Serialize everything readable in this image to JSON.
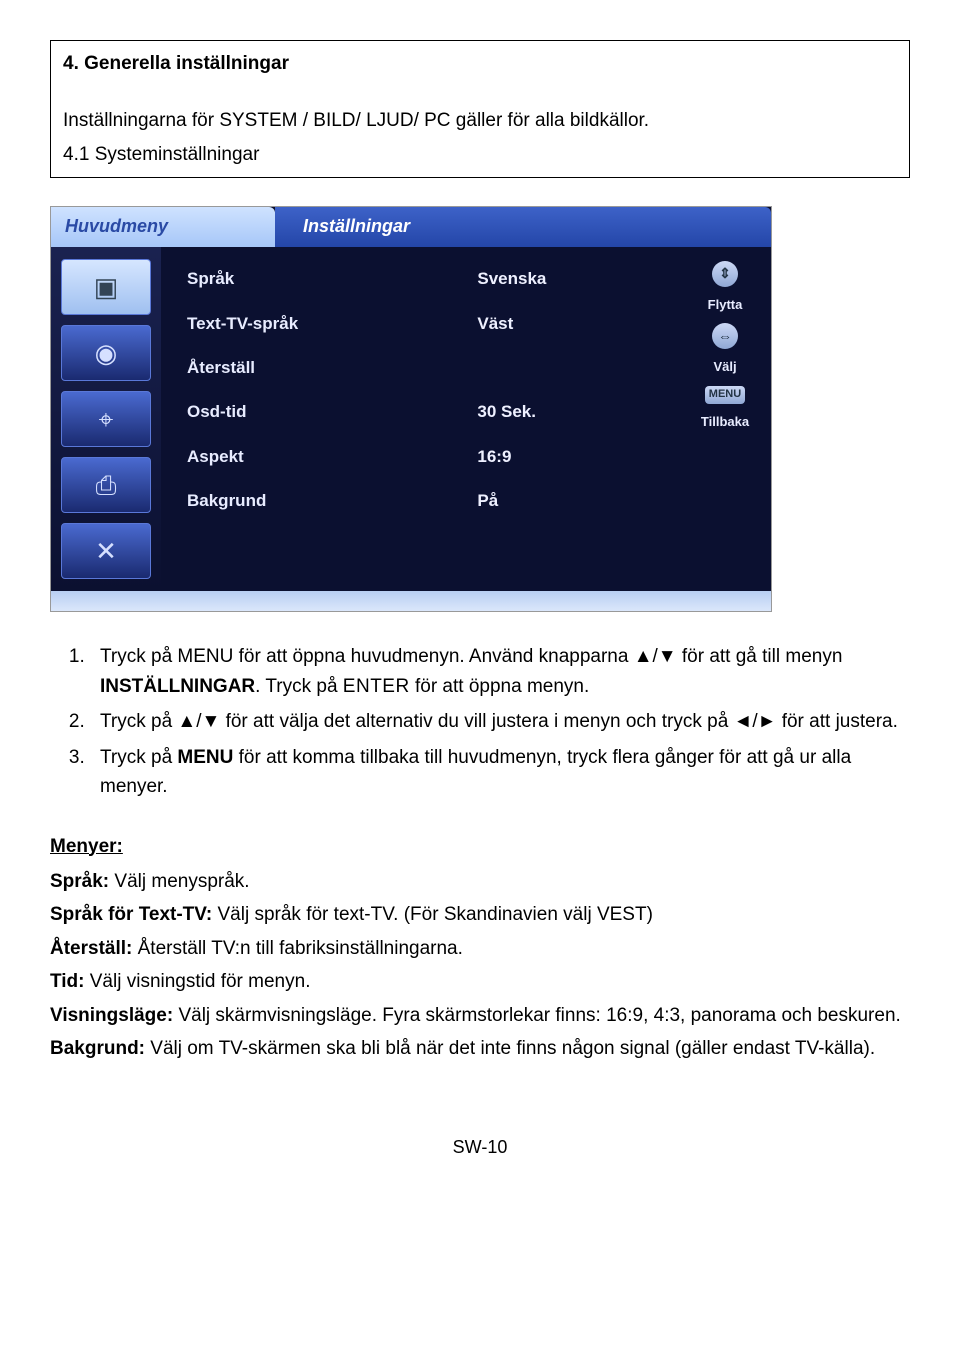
{
  "box": {
    "heading": "4. Generella inställningar",
    "intro": "Inställningarna för SYSTEM / BILD/ LJUD/ PC gäller för alla bildkällor.",
    "sub": "4.1 Systeminställningar"
  },
  "tvmenu": {
    "header_left": "Huvudmeny",
    "header_right": "Inställningar",
    "rows": [
      {
        "label": "Språk",
        "value": "Svenska"
      },
      {
        "label": "Text-TV-språk",
        "value": "Väst"
      },
      {
        "label": "Återställ",
        "value": ""
      },
      {
        "label": "Osd-tid",
        "value": "30 Sek."
      },
      {
        "label": "Aspekt",
        "value": "16:9"
      },
      {
        "label": "Bakgrund",
        "value": "På"
      }
    ],
    "right": {
      "move": "Flytta",
      "select": "Välj",
      "menu_btn": "MENU",
      "back": "Tillbaka"
    }
  },
  "steps": {
    "s1a": "Tryck på MENU för att öppna huvudmenyn. Använd knapparna ",
    "s1b": " för att gå till menyn ",
    "s1c": ". Tryck på ",
    "s1d": " för att öppna menyn.",
    "updown": "▲/▼",
    "installningar": "INSTÄLLNINGAR",
    "enter": "ENTER",
    "s2a": "Tryck på ",
    "s2b": " för att välja det alternativ du vill justera i menyn och tryck på ",
    "s2c": " för att justera.",
    "leftright": "◄/►",
    "s3a": "Tryck på ",
    "s3b": " för att komma tillbaka till huvudmenyn, tryck flera gånger för att gå ur alla menyer.",
    "menu_bold": "MENU"
  },
  "menyer": {
    "title": "Menyer:",
    "m1_head": "Språk:",
    "m1_body": " Välj menyspråk.",
    "m2_head": "Språk för Text-TV:",
    "m2_body": " Välj språk för text-TV. (För Skandinavien välj VEST)",
    "m3_head": "Återställ:",
    "m3_body": " Återställ TV:n till fabriksinställningarna.",
    "m4_head": "Tid:",
    "m4_body": " Välj visningstid för menyn.",
    "m5_head": "Visningsläge:",
    "m5_body": " Välj skärmvisningsläge. Fyra skärmstorlekar finns: 16:9, 4:3, panorama och beskuren.",
    "m6_head": "Bakgrund:",
    "m6_body": " Välj om TV-skärmen ska bli blå när det inte finns någon signal (gäller endast TV-källa)."
  },
  "footer": "SW-10"
}
